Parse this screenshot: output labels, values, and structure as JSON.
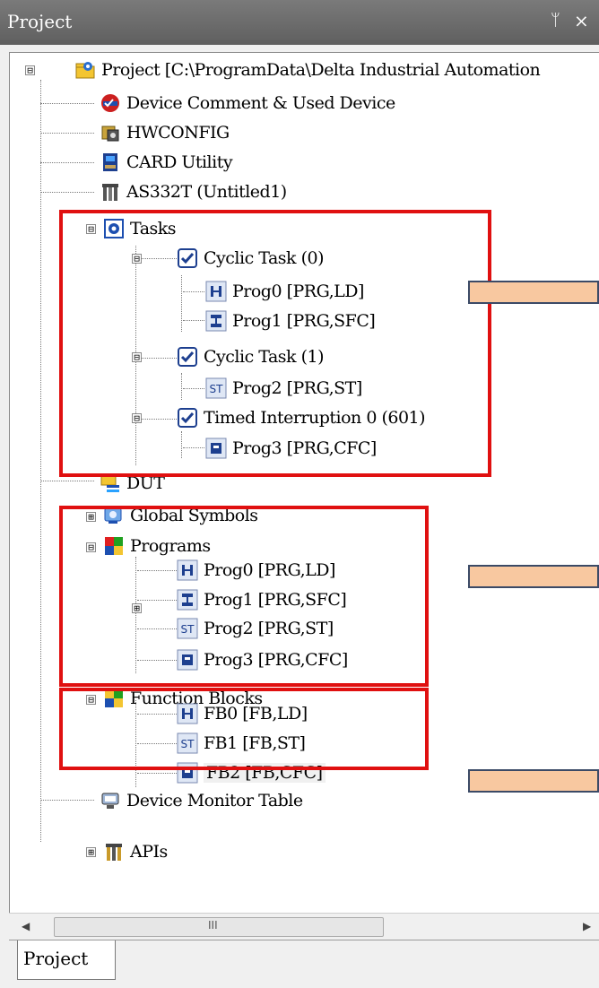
{
  "panel": {
    "title": "Project",
    "pin_icon": "pin-icon",
    "close_icon": "close-icon",
    "tab_label": "Project"
  },
  "tree": {
    "root": "Project [C:\\ProgramData\\Delta Industrial Automation",
    "device_comment": "Device Comment & Used Device",
    "hwconfig": "HWCONFIG",
    "card_utility": "CARD Utility",
    "as332t": "AS332T  (Untitled1)",
    "tasks": "Tasks",
    "cyclic0": "Cyclic Task (0)",
    "cyclic0_prog0": "Prog0 [PRG,LD]",
    "cyclic0_prog1": "Prog1 [PRG,SFC]",
    "cyclic1": "Cyclic Task (1)",
    "cyclic1_prog2": "Prog2 [PRG,ST]",
    "timed": "Timed Interruption 0 (601)",
    "timed_prog3": "Prog3 [PRG,CFC]",
    "dut": "DUT",
    "global_symbols": "Global Symbols",
    "programs": "Programs",
    "programs_prog0": "Prog0 [PRG,LD]",
    "programs_prog1": "Prog1 [PRG,SFC]",
    "programs_prog2": "Prog2 [PRG,ST]",
    "programs_prog3": "Prog3 [PRG,CFC]",
    "function_blocks": "Function Blocks",
    "fb0": "FB0 [FB,LD]",
    "fb1": "FB1 [FB,ST]",
    "fb2": "FB2 [FB,CFC]",
    "device_monitor": "Device Monitor Table",
    "apis": "APIs"
  },
  "expanders": {
    "minus": "⊟",
    "plus": "⊞"
  },
  "scrollbar": {
    "left_arrow": "◀",
    "right_arrow": "▶",
    "grip": "III"
  },
  "colors": {
    "highlight_box": "#e01010",
    "callout_fill": "#f8c8a0",
    "callout_border": "#3b4a66",
    "titlebar": "#6b6b6b"
  }
}
